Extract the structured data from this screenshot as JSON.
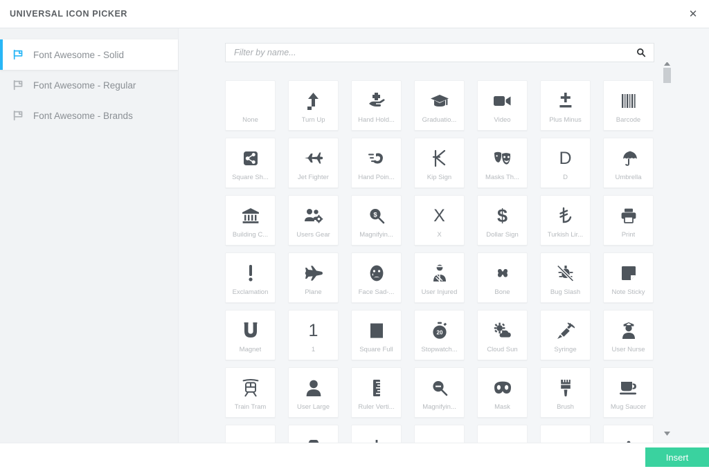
{
  "header": {
    "title": "UNIVERSAL ICON PICKER",
    "close_label": "✕",
    "close_icon": "close-icon"
  },
  "sidebar": {
    "items": [
      {
        "label": "Font Awesome - Solid",
        "icon": "flag-icon",
        "active": true
      },
      {
        "label": "Font Awesome - Regular",
        "icon": "flag-icon",
        "active": false
      },
      {
        "label": "Font Awesome - Brands",
        "icon": "flag-icon",
        "active": false
      }
    ]
  },
  "search": {
    "placeholder": "Filter by name...",
    "value": "",
    "icon": "search-icon"
  },
  "scrollbar": {
    "up_arrow_icon": "chevron-up-icon",
    "down_arrow_icon": "chevron-down-icon",
    "thumb_icon": "scroll-thumb"
  },
  "footer": {
    "insert_label": "Insert"
  },
  "colors": {
    "accent_blue": "#29b6f6",
    "insert_green": "#3ad29f",
    "icon_gray": "#4e555c",
    "label_gray": "#b6babe",
    "panel_bg": "#f4f6f8",
    "card_bg": "#ffffff"
  },
  "icons": [
    {
      "label": "None",
      "glyph": "none"
    },
    {
      "label": "Turn Up",
      "glyph": "turn-up"
    },
    {
      "label": "Hand Hold...",
      "glyph": "hand-holding-medical"
    },
    {
      "label": "Graduatio...",
      "glyph": "graduation-cap"
    },
    {
      "label": "Video",
      "glyph": "video"
    },
    {
      "label": "Plus Minus",
      "glyph": "plus-minus"
    },
    {
      "label": "Barcode",
      "glyph": "barcode"
    },
    {
      "label": "Square Sh...",
      "glyph": "square-share-nodes"
    },
    {
      "label": "Jet Fighter",
      "glyph": "jet-fighter"
    },
    {
      "label": "Hand Poin...",
      "glyph": "hand-pointer"
    },
    {
      "label": "Kip Sign",
      "glyph": "kip-sign"
    },
    {
      "label": "Masks Th...",
      "glyph": "masks-theater"
    },
    {
      "label": "D",
      "glyph": "letter-d"
    },
    {
      "label": "Umbrella",
      "glyph": "umbrella"
    },
    {
      "label": "Building C...",
      "glyph": "building-columns"
    },
    {
      "label": "Users Gear",
      "glyph": "users-gear"
    },
    {
      "label": "Magnifyin...",
      "glyph": "magnifying-glass-dollar"
    },
    {
      "label": "X",
      "glyph": "letter-x"
    },
    {
      "label": "Dollar Sign",
      "glyph": "dollar-sign"
    },
    {
      "label": "Turkish Lir...",
      "glyph": "turkish-lira-sign"
    },
    {
      "label": "Print",
      "glyph": "print"
    },
    {
      "label": "Exclamation",
      "glyph": "exclamation"
    },
    {
      "label": "Plane",
      "glyph": "plane"
    },
    {
      "label": "Face Sad-...",
      "glyph": "face-sad-tear"
    },
    {
      "label": "User Injured",
      "glyph": "user-injured"
    },
    {
      "label": "Bone",
      "glyph": "bone"
    },
    {
      "label": "Bug Slash",
      "glyph": "bug-slash"
    },
    {
      "label": "Note Sticky",
      "glyph": "note-sticky"
    },
    {
      "label": "Magnet",
      "glyph": "magnet"
    },
    {
      "label": "1",
      "glyph": "digit-one"
    },
    {
      "label": "Square Full",
      "glyph": "square-full"
    },
    {
      "label": "Stopwatch...",
      "glyph": "stopwatch-20"
    },
    {
      "label": "Cloud Sun",
      "glyph": "cloud-sun"
    },
    {
      "label": "Syringe",
      "glyph": "syringe"
    },
    {
      "label": "User Nurse",
      "glyph": "user-nurse"
    },
    {
      "label": "Train Tram",
      "glyph": "train-tram"
    },
    {
      "label": "User Large",
      "glyph": "user-large"
    },
    {
      "label": "Ruler Verti...",
      "glyph": "ruler-vertical"
    },
    {
      "label": "Magnifyin...",
      "glyph": "magnifying-glass-minus"
    },
    {
      "label": "Mask",
      "glyph": "mask"
    },
    {
      "label": "Brush",
      "glyph": "brush"
    },
    {
      "label": "Mug Saucer",
      "glyph": "mug-saucer"
    },
    {
      "label": "",
      "glyph": "car"
    },
    {
      "label": "",
      "glyph": "bars-partial"
    },
    {
      "label": "",
      "glyph": "dome"
    },
    {
      "label": "",
      "glyph": "dot-partial"
    },
    {
      "label": "",
      "glyph": "dome2"
    },
    {
      "label": "",
      "glyph": "scale-partial"
    },
    {
      "label": "",
      "glyph": "blank-partial"
    }
  ]
}
